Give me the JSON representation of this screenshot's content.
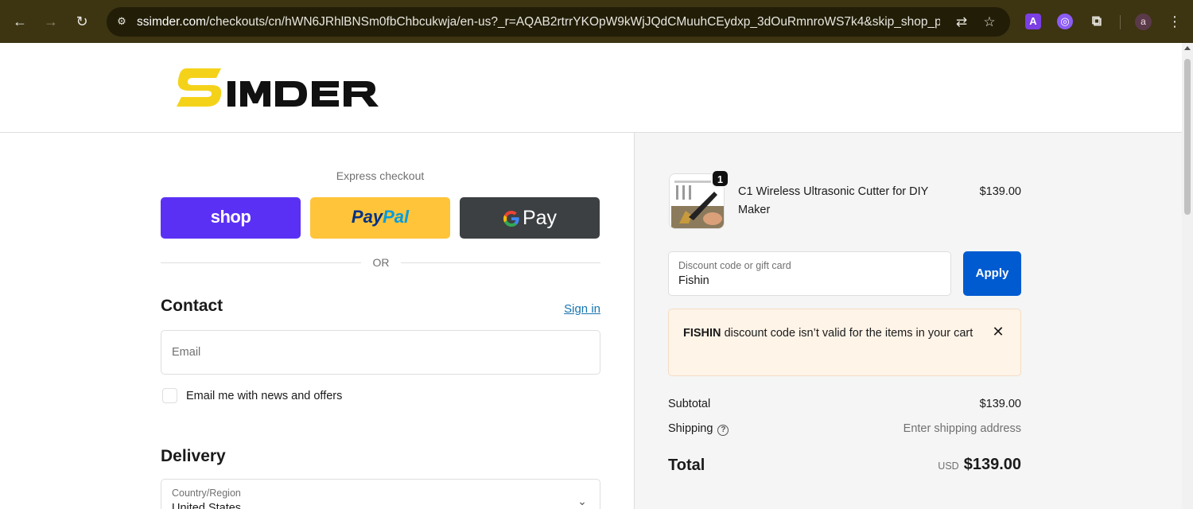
{
  "browser": {
    "url_domain": "ssimder.com",
    "url_path": "/checkouts/cn/hWN6JRhlBNSm0fbChbcukwja/en-us?_r=AQAB2rtrrYKOpW9kWjJQdCMuuhCEydxp_3dOuRmnroWS7k4&skip_shop_pay...",
    "profile_initial": "a",
    "extension_a_label": "A"
  },
  "header": {
    "logo_text": "SIMDER",
    "logo_accent_color": "#f5d21a",
    "logo_dark_color": "#111111"
  },
  "express": {
    "title": "Express checkout",
    "shop_label": "shop",
    "paypal_part1": "Pay",
    "paypal_part2": "Pal",
    "gpay_label": "Pay",
    "shop_color": "#5a31f4",
    "paypal_color": "#ffc439",
    "gpay_color": "#3c4043"
  },
  "divider": {
    "or_label": "OR"
  },
  "contact": {
    "title": "Contact",
    "signin_label": "Sign in",
    "email_placeholder": "Email",
    "newsletter_label": "Email me with news and offers",
    "newsletter_checked": false
  },
  "delivery": {
    "title": "Delivery",
    "country_label": "Country/Region",
    "country_value": "United States"
  },
  "order": {
    "product_name": "C1 Wireless Ultrasonic Cutter for DIY Maker",
    "product_price": "$139.00",
    "quantity": "1"
  },
  "discount": {
    "label": "Discount code or gift card",
    "value": "Fishin",
    "apply_label": "Apply",
    "apply_color": "#005bd1",
    "error_code": "FISHIN",
    "error_message": "discount code isn’t valid for the items in your cart"
  },
  "summary": {
    "subtotal_label": "Subtotal",
    "subtotal_value": "$139.00",
    "shipping_label": "Shipping",
    "shipping_value": "Enter shipping address",
    "total_label": "Total",
    "total_currency": "USD",
    "total_value": "$139.00"
  }
}
